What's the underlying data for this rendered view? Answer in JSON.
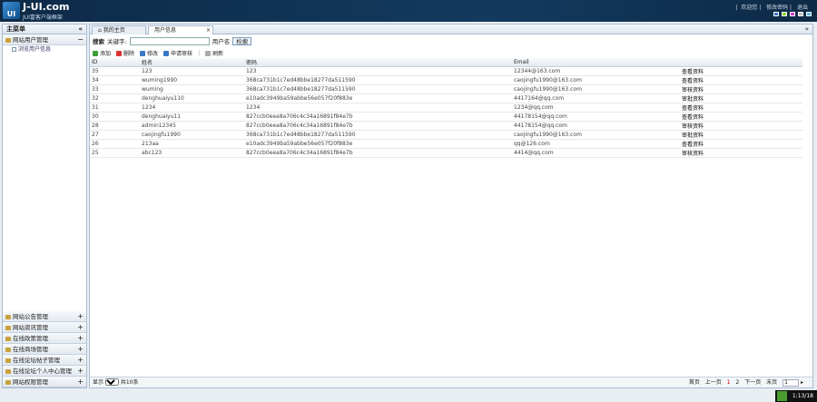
{
  "header": {
    "logo": "JUI",
    "title": "J-UI.com",
    "subtitle": "JUI富客户端框架",
    "links": [
      "欢迎您",
      "修改密码",
      "退出"
    ],
    "theme_colors": [
      "#3a78c9",
      "#8ed43a",
      "#d33ad3",
      "#bbbbbb",
      "#5ab8ee"
    ]
  },
  "sidebar": {
    "title": "主菜单",
    "collapse": "«",
    "open_group": {
      "label": "网站用户管理",
      "toggle": "−",
      "items": [
        "浏览用户信息"
      ]
    },
    "groups": [
      "网站公告管理",
      "网站资讯管理",
      "在线政策管理",
      "在线商场管理",
      "在线论坛帖子管理",
      "在线论坛个人中心管理",
      "网站权限管理"
    ],
    "expand": "+"
  },
  "tabs": [
    {
      "label": "我的主页"
    },
    {
      "label": "用户信息",
      "close": "×"
    }
  ],
  "search": {
    "label": "搜索",
    "keyword_label": "关键字:",
    "value": "",
    "field": "用户名",
    "button": "检索"
  },
  "toolbar": [
    "添加",
    "删除",
    "修改",
    "申请审核",
    "刷新"
  ],
  "table": {
    "columns": [
      "ID",
      "姓名",
      "密码",
      "Email",
      ""
    ],
    "rows": [
      [
        "35",
        "123",
        "123",
        "12344@163.com",
        "查看资料"
      ],
      [
        "34",
        "wuming1990",
        "368ca731b1c7ed48bbe18277da511590",
        "caojingfu1990@163.com",
        "查看资料"
      ],
      [
        "33",
        "wuming",
        "368ca731b1c7ed48bbe18277da511590",
        "caojingfu1990@163.com",
        "审核资料"
      ],
      [
        "32",
        "denghuaiyu110",
        "e10adc3949ba59abbe56e057f20f883e",
        "4417164@qq.com",
        "审批资料"
      ],
      [
        "31",
        "1234",
        "1234",
        "1234@qq.com",
        "查看资料"
      ],
      [
        "30",
        "denghuaiyu11",
        "827ccb0eea8a706c4c34a16891f84e7b",
        "44178154@qq.com",
        "查看资料"
      ],
      [
        "28",
        "admin12345",
        "827ccb0eea8a706c4c34a16891f84e7b",
        "44178154@qq.com",
        "审核资料"
      ],
      [
        "27",
        "caojingfu1990",
        "368ca731b1c7ed48bbe18277da511590",
        "caojingfu1990@163.com",
        "审批资料"
      ],
      [
        "26",
        "213aa",
        "e10adc3949ba59abbe56e057f20f883e",
        "qq@126.com",
        "查看资料"
      ],
      [
        "25",
        "abc123",
        "827ccb0eea8a706c4c34a16891f84e7b",
        "4414@qq.com",
        "审核资料"
      ]
    ]
  },
  "pager": {
    "show": "显示",
    "page_size": "10",
    "total": "共10条",
    "first": "首页",
    "prev": "上一页",
    "pages": [
      "1",
      "2"
    ],
    "next": "下一页",
    "last": "末页",
    "current": "1"
  },
  "tray": {
    "time": "1:13/18"
  },
  "expand_icon": "»"
}
